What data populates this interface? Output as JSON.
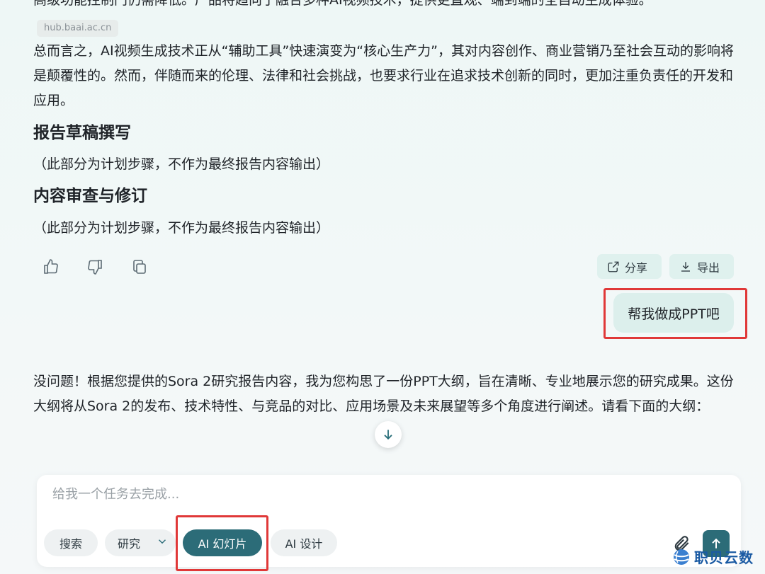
{
  "colors": {
    "accent": "#2c6c78",
    "highlight": "#e03838",
    "bubble": "#dcefec",
    "action_bg": "#dff1ee"
  },
  "article": {
    "cut_line": "高级功能控制门仍需降低。产品将趋向于融合多种AI视频技术，提供更直观、端到端的全自动生成体验。",
    "source_chip": "hub.baai.ac.cn",
    "summary": "总而言之，AI视频生成技术正从“辅助工具”快速演变为“核心生产力”，其对内容创作、商业营销乃至社会互动的影响将是颠覆性的。然而，伴随而来的伦理、法律和社会挑战，也要求行业在追求技术创新的同时，更加注重负责任的开发和应用。",
    "section1_title": "报告草稿撰写",
    "section1_note": "（此部分为计划步骤，不作为最终报告内容输出）",
    "section2_title": "内容审查与修订",
    "section2_note": "（此部分为计划步骤，不作为最终报告内容输出）"
  },
  "actions": {
    "like_icon": "thumbs-up-icon",
    "dislike_icon": "thumbs-down-icon",
    "copy_icon": "copy-icon",
    "share_label": "分享",
    "export_label": "导出"
  },
  "user_message": "帮我做成PPT吧",
  "assistant_reply": "没问题！根据您提供的Sora 2研究报告内容，我为您构思了一份PPT大纲，旨在清晰、专业地展示您的研究成果。这份大纲将从Sora 2的发布、技术特性、与竞品的对比、应用场景及未来展望等多个角度进行阐述。请看下面的大纲：",
  "composer": {
    "placeholder": "给我一个任务去完成...",
    "value": "",
    "chips": [
      "搜索",
      "研究",
      "AI 幻灯片",
      "AI 设计"
    ],
    "active_chip": "AI 幻灯片"
  },
  "watermark": "职贝云数"
}
